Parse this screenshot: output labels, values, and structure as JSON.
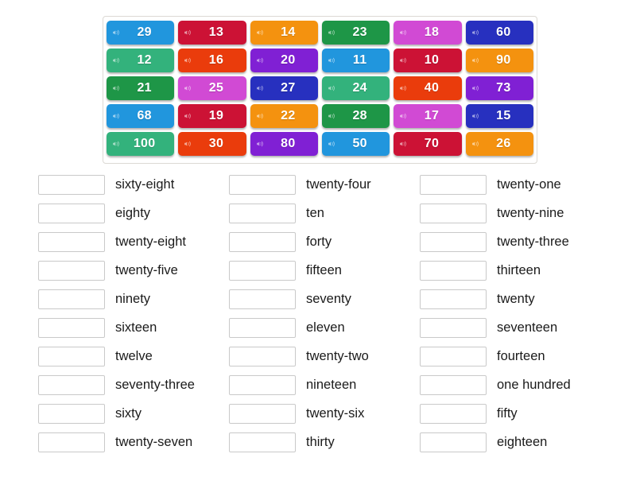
{
  "app": {
    "activity_type": "match-up",
    "icon_name": "speaker-icon"
  },
  "tile_grid": {
    "columns": 6,
    "rows": 5,
    "tiles": [
      {
        "value": "29",
        "color": "#2196dd"
      },
      {
        "value": "13",
        "color": "#cc1235"
      },
      {
        "value": "14",
        "color": "#f4920f"
      },
      {
        "value": "23",
        "color": "#1e9647"
      },
      {
        "value": "18",
        "color": "#d14ad4"
      },
      {
        "value": "60",
        "color": "#2730bf"
      },
      {
        "value": "12",
        "color": "#33b27c"
      },
      {
        "value": "16",
        "color": "#ea3c0c"
      },
      {
        "value": "20",
        "color": "#8020d4"
      },
      {
        "value": "11",
        "color": "#2196dd"
      },
      {
        "value": "10",
        "color": "#cc1235"
      },
      {
        "value": "90",
        "color": "#f4920f"
      },
      {
        "value": "21",
        "color": "#1e9647"
      },
      {
        "value": "25",
        "color": "#d14ad4"
      },
      {
        "value": "27",
        "color": "#2730bf"
      },
      {
        "value": "24",
        "color": "#33b27c"
      },
      {
        "value": "40",
        "color": "#ea3c0c"
      },
      {
        "value": "73",
        "color": "#8020d4"
      },
      {
        "value": "68",
        "color": "#2196dd"
      },
      {
        "value": "19",
        "color": "#cc1235"
      },
      {
        "value": "22",
        "color": "#f4920f"
      },
      {
        "value": "28",
        "color": "#1e9647"
      },
      {
        "value": "17",
        "color": "#d14ad4"
      },
      {
        "value": "15",
        "color": "#2730bf"
      },
      {
        "value": "100",
        "color": "#33b27c"
      },
      {
        "value": "30",
        "color": "#ea3c0c"
      },
      {
        "value": "80",
        "color": "#8020d4"
      },
      {
        "value": "50",
        "color": "#2196dd"
      },
      {
        "value": "70",
        "color": "#cc1235"
      },
      {
        "value": "26",
        "color": "#f4920f"
      }
    ]
  },
  "answer_columns": [
    {
      "items": [
        {
          "box_value": "",
          "label": "sixty-eight"
        },
        {
          "box_value": "",
          "label": "eighty"
        },
        {
          "box_value": "",
          "label": "twenty-eight"
        },
        {
          "box_value": "",
          "label": "twenty-five"
        },
        {
          "box_value": "",
          "label": "ninety"
        },
        {
          "box_value": "",
          "label": "sixteen"
        },
        {
          "box_value": "",
          "label": "twelve"
        },
        {
          "box_value": "",
          "label": "seventy-three"
        },
        {
          "box_value": "",
          "label": "sixty"
        },
        {
          "box_value": "",
          "label": "twenty-seven"
        }
      ]
    },
    {
      "items": [
        {
          "box_value": "",
          "label": "twenty-four"
        },
        {
          "box_value": "",
          "label": "ten"
        },
        {
          "box_value": "",
          "label": "forty"
        },
        {
          "box_value": "",
          "label": "fifteen"
        },
        {
          "box_value": "",
          "label": "seventy"
        },
        {
          "box_value": "",
          "label": "eleven"
        },
        {
          "box_value": "",
          "label": "twenty-two"
        },
        {
          "box_value": "",
          "label": "nineteen"
        },
        {
          "box_value": "",
          "label": "twenty-six"
        },
        {
          "box_value": "",
          "label": "thirty"
        }
      ]
    },
    {
      "items": [
        {
          "box_value": "",
          "label": "twenty-one"
        },
        {
          "box_value": "",
          "label": "twenty-nine"
        },
        {
          "box_value": "",
          "label": "twenty-three"
        },
        {
          "box_value": "",
          "label": "thirteen"
        },
        {
          "box_value": "",
          "label": "twenty"
        },
        {
          "box_value": "",
          "label": "seventeen"
        },
        {
          "box_value": "",
          "label": "fourteen"
        },
        {
          "box_value": "",
          "label": "one hundred"
        },
        {
          "box_value": "",
          "label": "fifty"
        },
        {
          "box_value": "",
          "label": "eighteen"
        }
      ]
    }
  ]
}
